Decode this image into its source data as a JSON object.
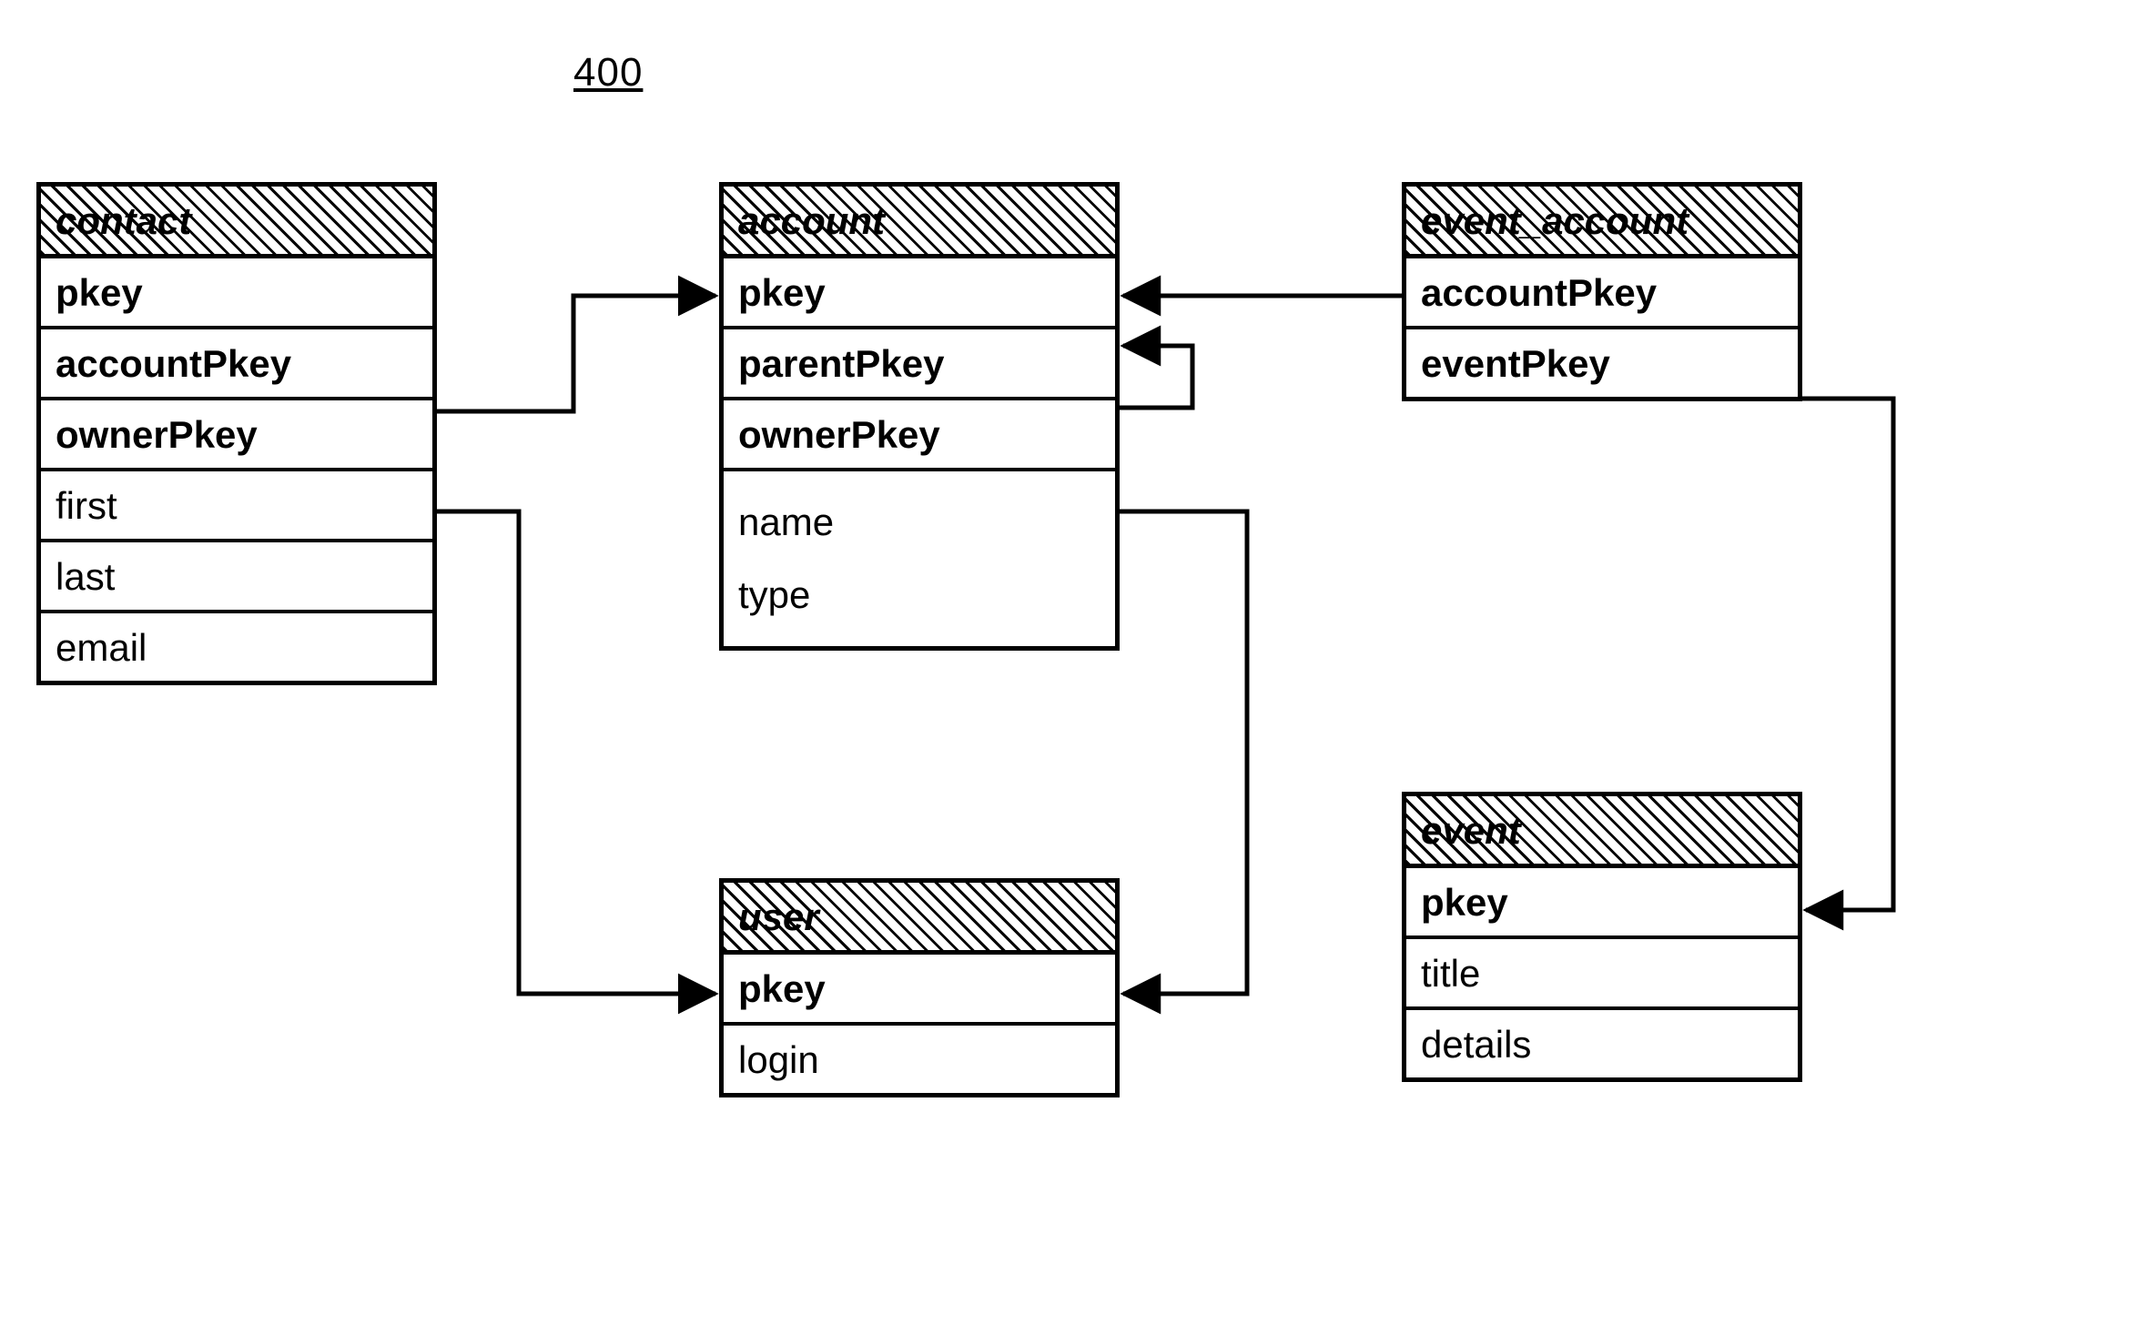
{
  "figure_number": "400",
  "entities": {
    "contact": {
      "title": "contact",
      "fields": {
        "pkey": "pkey",
        "accountPkey": "accountPkey",
        "ownerPkey": "ownerPkey",
        "first": "first",
        "last": "last",
        "email": "email"
      }
    },
    "account": {
      "title": "account",
      "fields": {
        "pkey": "pkey",
        "parentPkey": "parentPkey",
        "ownerPkey": "ownerPkey",
        "name": "name",
        "type": "type"
      }
    },
    "event_account": {
      "title": "event_account",
      "fields": {
        "accountPkey": "accountPkey",
        "eventPkey": "eventPkey"
      }
    },
    "user": {
      "title": "user",
      "fields": {
        "pkey": "pkey",
        "login": "login"
      }
    },
    "event": {
      "title": "event",
      "fields": {
        "pkey": "pkey",
        "title": "title",
        "details": "details"
      }
    }
  },
  "relationships": [
    {
      "from": "contact.accountPkey",
      "to": "account.pkey"
    },
    {
      "from": "contact.ownerPkey",
      "to": "user.pkey"
    },
    {
      "from": "account.parentPkey",
      "to": "account.pkey"
    },
    {
      "from": "account.ownerPkey",
      "to": "user.pkey"
    },
    {
      "from": "event_account.accountPkey",
      "to": "account.pkey"
    },
    {
      "from": "event_account.eventPkey",
      "to": "event.pkey"
    }
  ]
}
